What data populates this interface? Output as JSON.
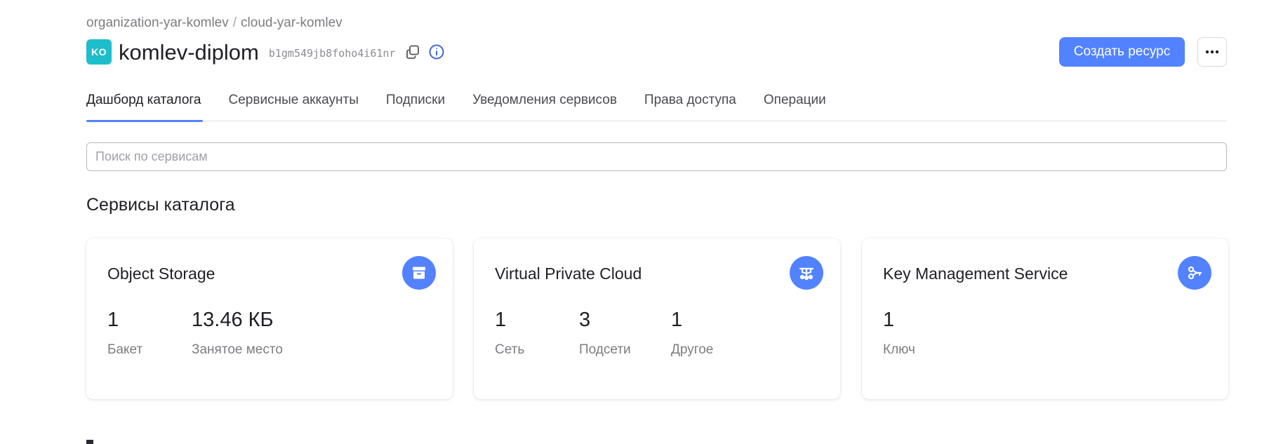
{
  "breadcrumb": {
    "organization": "organization-yar-komlev",
    "separator": "/",
    "cloud": "cloud-yar-komlev"
  },
  "folder": {
    "badge": "KO",
    "title": "komlev-diplom",
    "id": "b1gm549jb8foho4i61nr"
  },
  "header": {
    "create_label": "Создать ресурс",
    "more_label": "···"
  },
  "tabs": [
    {
      "label": "Дашборд каталога",
      "active": true
    },
    {
      "label": "Сервисные аккаунты"
    },
    {
      "label": "Подписки"
    },
    {
      "label": "Уведомления сервисов"
    },
    {
      "label": "Права доступа"
    },
    {
      "label": "Операции"
    }
  ],
  "search": {
    "placeholder": "Поиск по сервисам",
    "value": ""
  },
  "section_title": "Сервисы каталога",
  "cards": [
    {
      "title": "Object Storage",
      "icon": "storage-icon",
      "stats": [
        {
          "value": "1",
          "label": "Бакет"
        },
        {
          "value": "13.46 КБ",
          "label": "Занятое место"
        }
      ]
    },
    {
      "title": "Virtual Private Cloud",
      "icon": "network-icon",
      "stats": [
        {
          "value": "1",
          "label": "Сеть"
        },
        {
          "value": "3",
          "label": "Подсети"
        },
        {
          "value": "1",
          "label": "Другое"
        }
      ]
    },
    {
      "title": "Key Management Service",
      "icon": "key-icon",
      "stats": [
        {
          "value": "1",
          "label": "Ключ"
        }
      ]
    }
  ],
  "colors": {
    "accent": "#5282ff",
    "badge": "#1ebdcb",
    "muted_text": "#7d7d82"
  }
}
